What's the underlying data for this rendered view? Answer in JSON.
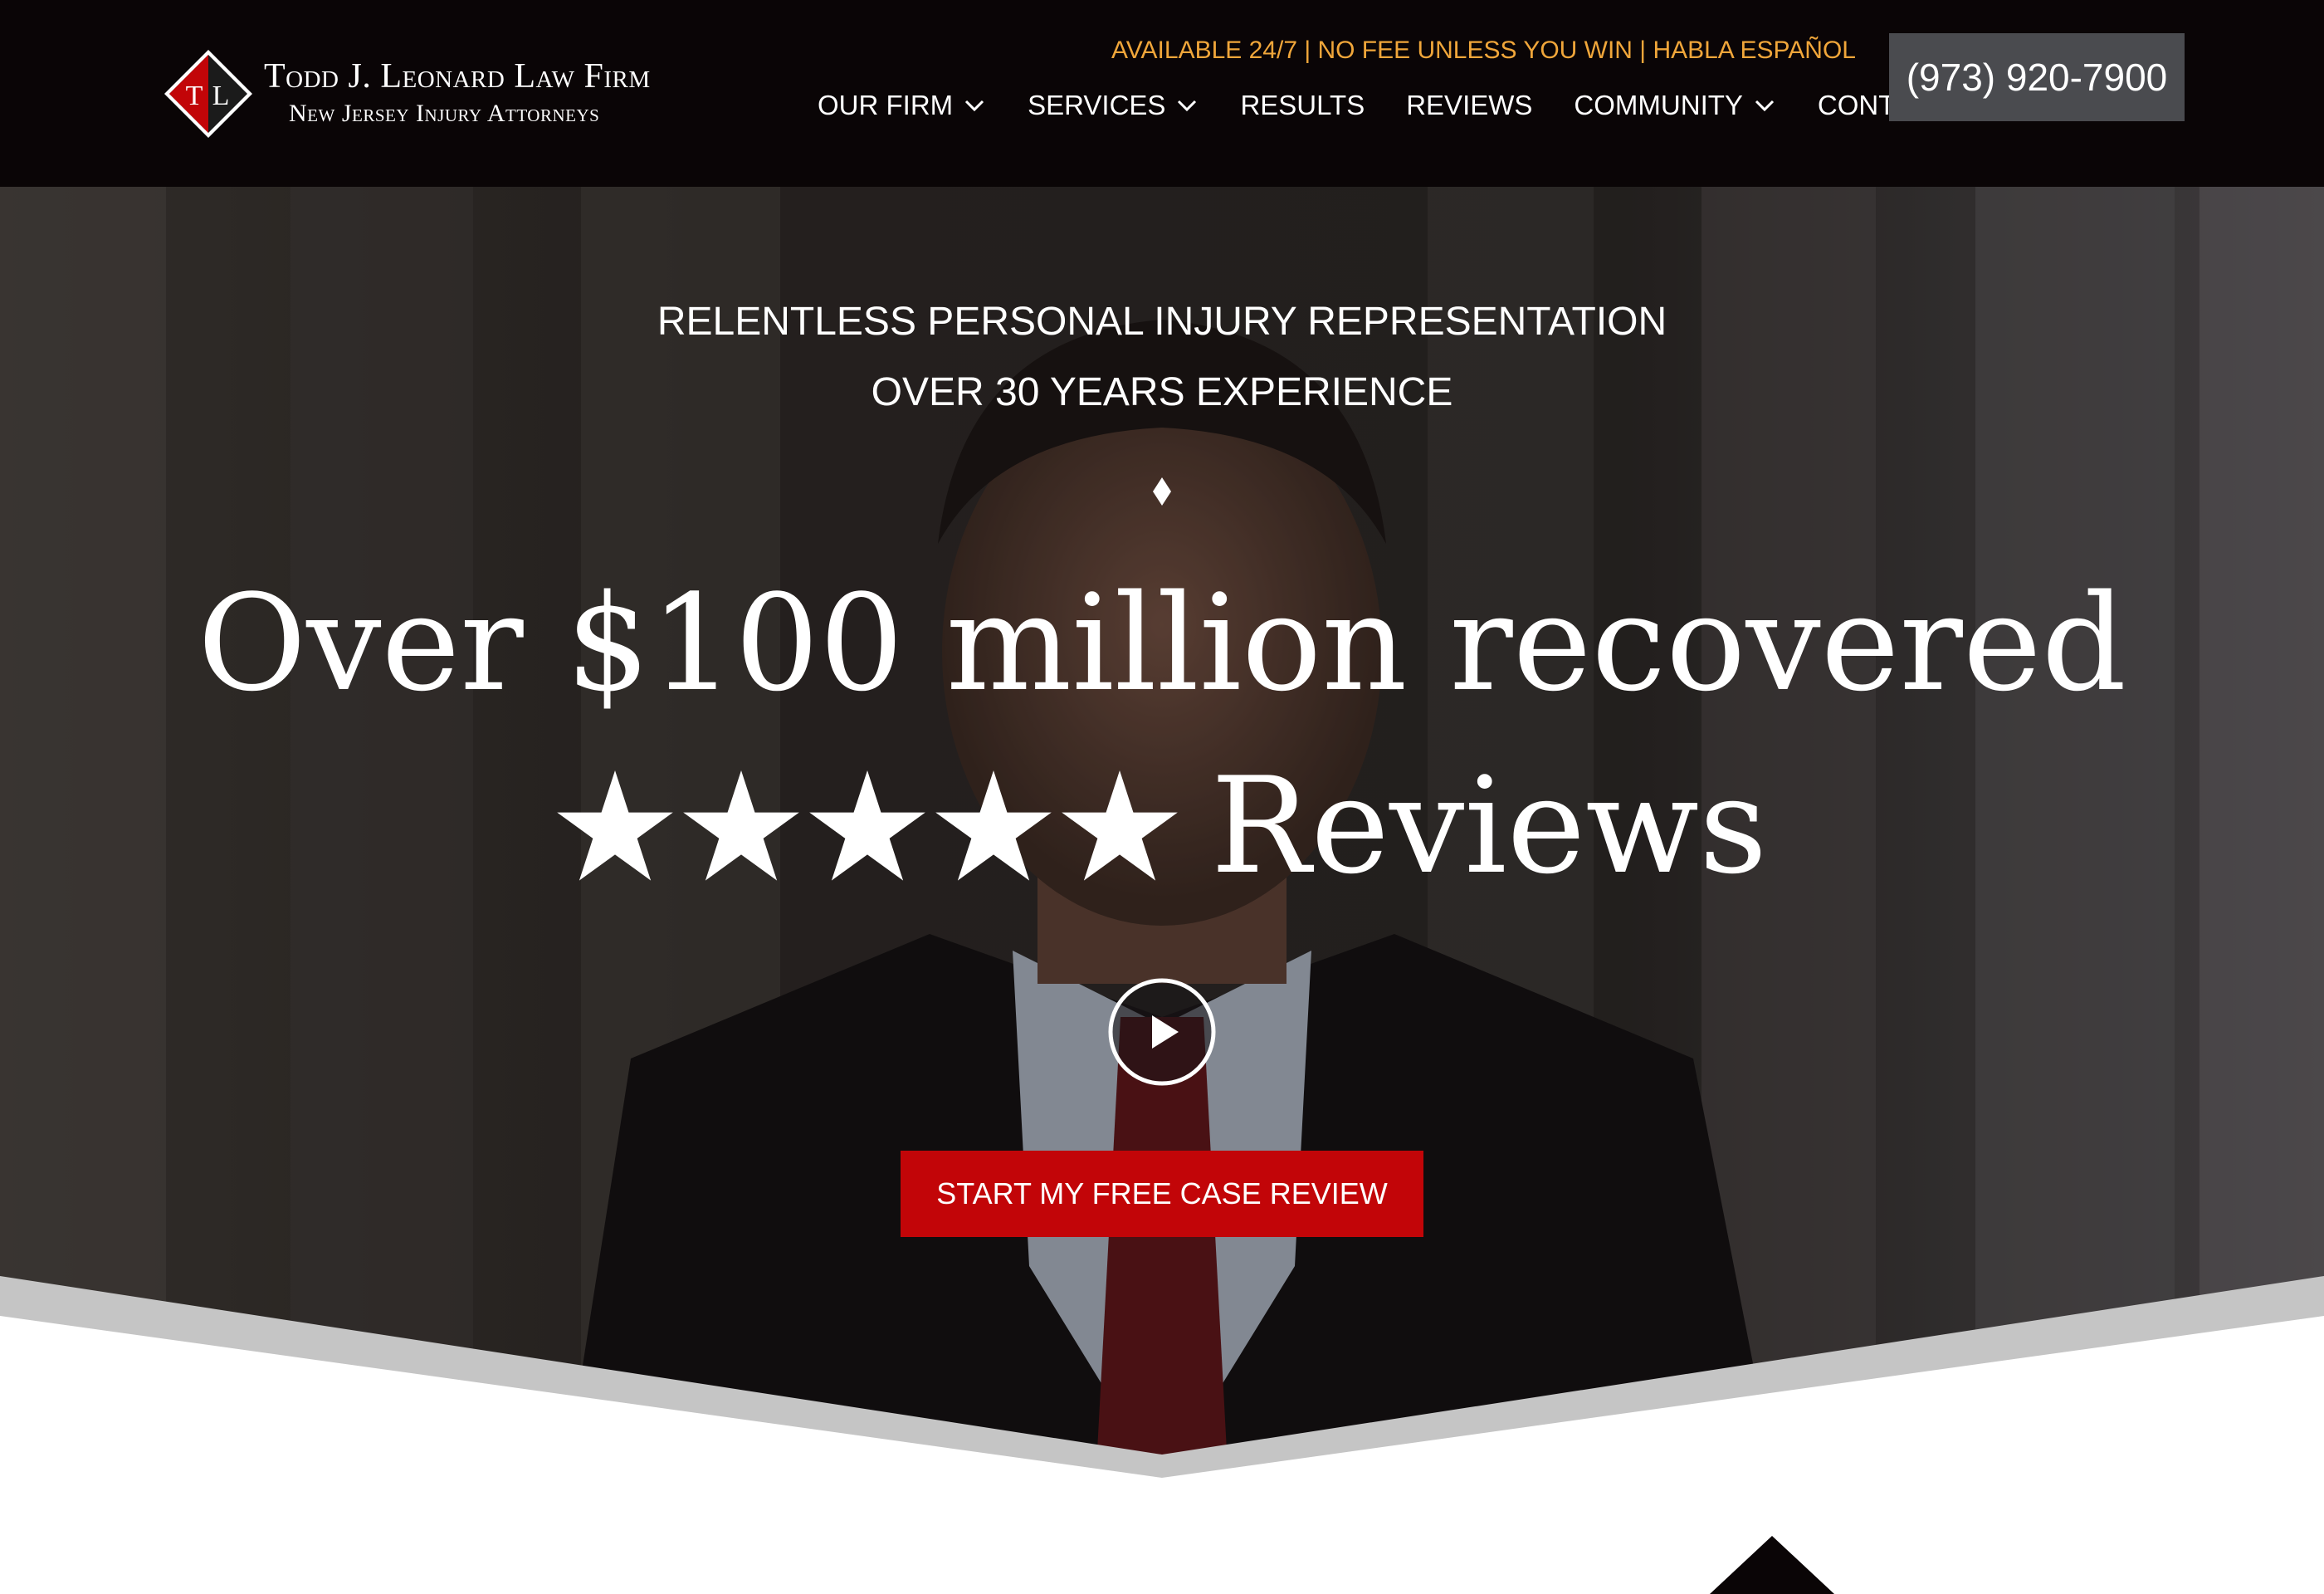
{
  "brand": {
    "monogram_left": "T",
    "monogram_right": "L",
    "name": "Todd J. Leonard Law Firm",
    "tagline": "New Jersey Injury Attorneys",
    "accent_red": "#c20508"
  },
  "header": {
    "topline": "AVAILABLE 24/7 | NO FEE UNLESS YOU WIN | HABLA ESPAÑOL",
    "topline_color": "#f0a63a",
    "phone": "(973) 920-7900",
    "nav": [
      {
        "label": "OUR FIRM",
        "has_dropdown": true
      },
      {
        "label": "SERVICES",
        "has_dropdown": true
      },
      {
        "label": "RESULTS",
        "has_dropdown": false
      },
      {
        "label": "REVIEWS",
        "has_dropdown": false
      },
      {
        "label": "COMMUNITY",
        "has_dropdown": true
      },
      {
        "label": "CONTACT",
        "has_dropdown": false
      }
    ]
  },
  "hero": {
    "line1": "RELENTLESS PERSONAL INJURY REPRESENTATION",
    "line2": "OVER 30 YEARS EXPERIENCE",
    "title": "Over $100 million recovered",
    "rating_stars": 5,
    "reviews_word": "Reviews",
    "cta": "START MY FREE CASE REVIEW"
  }
}
